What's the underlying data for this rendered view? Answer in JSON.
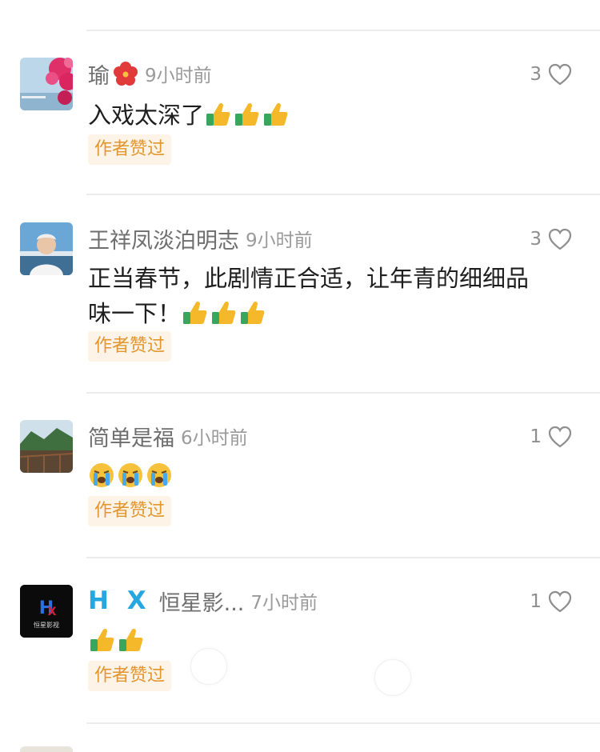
{
  "comments": [
    {
      "username": "瑜",
      "timestamp": "9小时前",
      "likes": "3",
      "lines": [
        "入戏太深了"
      ],
      "emoji": "thumbs-up-icon",
      "emoji_count": 3,
      "badge": "作者赞过",
      "avatar": "flowers-lake-avatar",
      "name_emoji": "hibiscus-icon"
    },
    {
      "username": "王祥凤淡泊明志",
      "timestamp": "9小时前",
      "likes": "3",
      "lines": [
        "正当春节，此剧情正合适，让年青的细细品",
        "味一下！"
      ],
      "emoji": "thumbs-up-icon",
      "emoji_count": 3,
      "badge": "作者赞过",
      "avatar": "elderly-man-avatar"
    },
    {
      "username": "简单是福",
      "timestamp": "6小时前",
      "likes": "1",
      "lines": [
        ""
      ],
      "emoji": "crying-face-icon",
      "emoji_count": 3,
      "badge": "作者赞过",
      "avatar": "mountain-bridge-avatar"
    },
    {
      "username_prefix": "H X",
      "username": "恒星影...",
      "timestamp": "7小时前",
      "likes": "1",
      "lines": [
        ""
      ],
      "emoji": "thumbs-up-icon",
      "emoji_count": 2,
      "badge": "作者赞过",
      "avatar": "hengxing-logo-avatar",
      "avatar_text": "恒星影视"
    }
  ],
  "colors": {
    "badge_bg": "#fdf3e6",
    "badge_text": "#e2962f",
    "hx_blue": "#26a7e0"
  }
}
